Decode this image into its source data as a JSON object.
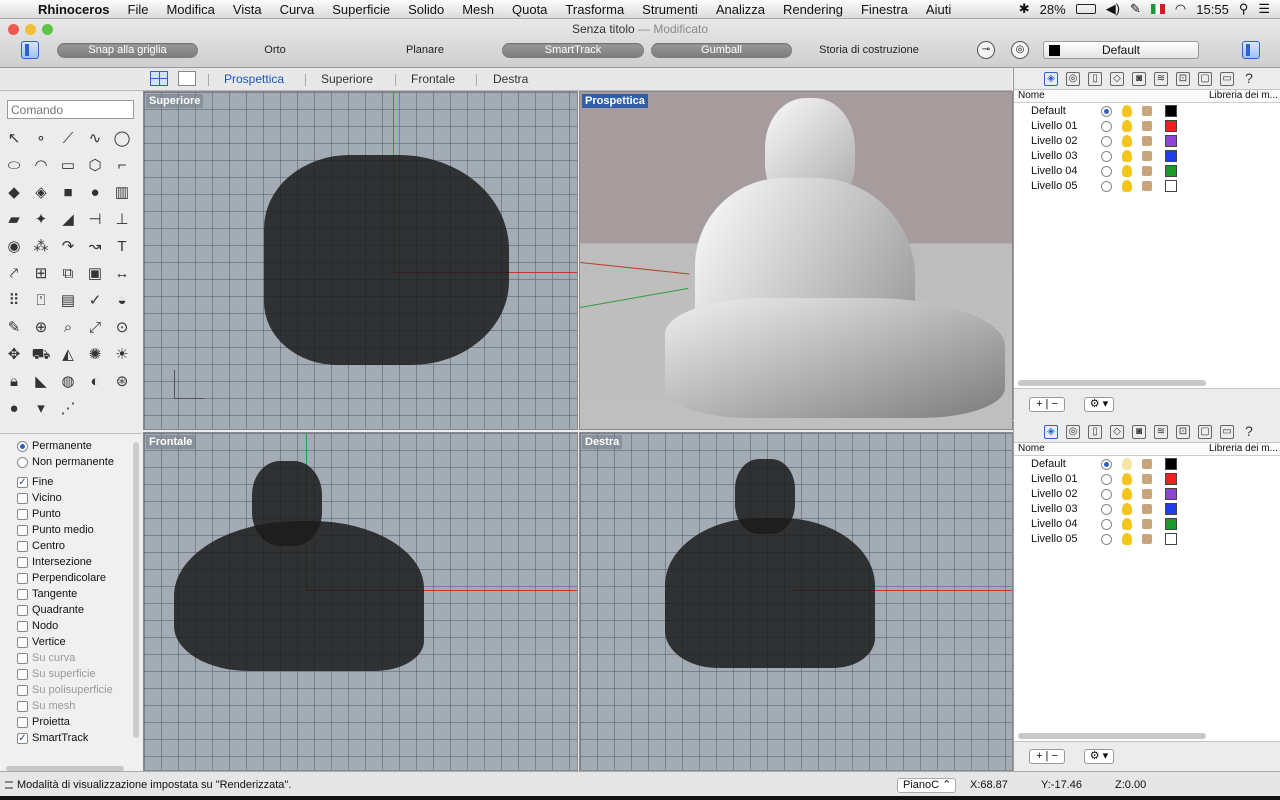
{
  "menubar": {
    "apple": "",
    "app": "Rhinoceros",
    "items": [
      "File",
      "Modifica",
      "Vista",
      "Curva",
      "Superficie",
      "Solido",
      "Mesh",
      "Quota",
      "Trasforma",
      "Strumenti",
      "Analizza",
      "Rendering",
      "Finestra",
      "Aiuti"
    ],
    "battery": "28%",
    "clock": "15:55"
  },
  "window": {
    "title": "Senza titolo",
    "modified": " — Modificato"
  },
  "toolbar": {
    "snap": "Snap alla griglia",
    "orto": "Orto",
    "planare": "Planare",
    "smarttrack": "SmartTrack",
    "gumball": "Gumball",
    "storia": "Storia di costruzione",
    "layer": "Default"
  },
  "viewport_tabs": [
    "Prospettica",
    "Superiore",
    "Frontale",
    "Destra"
  ],
  "command": {
    "placeholder": "Comando"
  },
  "viewports": {
    "top": "Superiore",
    "perspective": "Prospettica",
    "front": "Frontale",
    "right": "Destra"
  },
  "osnap": {
    "permanente": "Permanente",
    "non_permanente": "Non permanente",
    "items": [
      {
        "label": "Fine",
        "checked": true,
        "enabled": true
      },
      {
        "label": "Vicino",
        "checked": false,
        "enabled": true
      },
      {
        "label": "Punto",
        "checked": false,
        "enabled": true
      },
      {
        "label": "Punto medio",
        "checked": false,
        "enabled": true
      },
      {
        "label": "Centro",
        "checked": false,
        "enabled": true
      },
      {
        "label": "Intersezione",
        "checked": false,
        "enabled": true
      },
      {
        "label": "Perpendicolare",
        "checked": false,
        "enabled": true
      },
      {
        "label": "Tangente",
        "checked": false,
        "enabled": true
      },
      {
        "label": "Quadrante",
        "checked": false,
        "enabled": true
      },
      {
        "label": "Nodo",
        "checked": false,
        "enabled": true
      },
      {
        "label": "Vertice",
        "checked": false,
        "enabled": true
      },
      {
        "label": "Su curva",
        "checked": false,
        "enabled": false
      },
      {
        "label": "Su superficie",
        "checked": false,
        "enabled": false
      },
      {
        "label": "Su polisuperficie",
        "checked": false,
        "enabled": false
      },
      {
        "label": "Su mesh",
        "checked": false,
        "enabled": false
      },
      {
        "label": "Proietta",
        "checked": false,
        "enabled": true
      },
      {
        "label": "SmartTrack",
        "checked": true,
        "enabled": true
      }
    ]
  },
  "layers": {
    "col_name": "Nome",
    "col_lib": "Libreria dei m...",
    "rows": [
      {
        "name": "Default",
        "color": "#000000",
        "current": true
      },
      {
        "name": "Livello 01",
        "color": "#e8251c",
        "current": false
      },
      {
        "name": "Livello 02",
        "color": "#8e44d6",
        "current": false
      },
      {
        "name": "Livello 03",
        "color": "#1f3fe6",
        "current": false
      },
      {
        "name": "Livello 04",
        "color": "#1a9a2b",
        "current": false
      },
      {
        "name": "Livello 05",
        "color": "#ffffff",
        "current": false
      }
    ],
    "add": "+",
    "remove": "−",
    "gear": "⚙ ▾"
  },
  "status": {
    "message": "Modalità di visualizzazione impostata su \"Renderizzata\".",
    "cplane": "PianoC",
    "x": "X:68.87",
    "y": "Y:-17.46",
    "z": "Z:0.00"
  }
}
